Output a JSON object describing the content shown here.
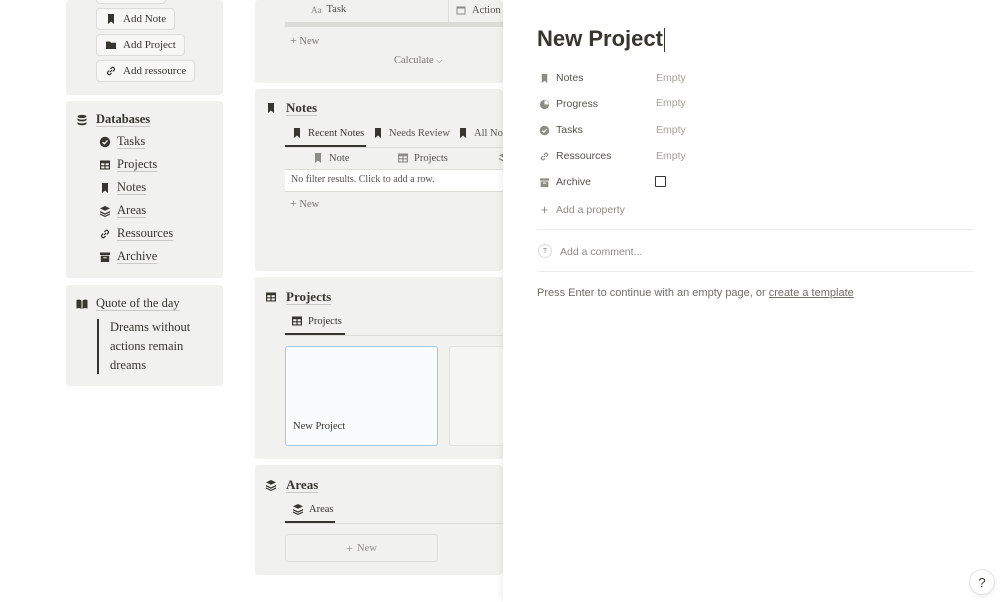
{
  "quick_actions": {
    "add_note": "Add Note",
    "add_project": "Add Project",
    "add_resource": "Add ressource"
  },
  "databases": {
    "title": "Databases",
    "items": [
      {
        "label": "Tasks",
        "icon": "check-circle-icon"
      },
      {
        "label": "Projects",
        "icon": "table-icon"
      },
      {
        "label": "Notes",
        "icon": "bookmark-icon"
      },
      {
        "label": "Areas",
        "icon": "layers-icon"
      },
      {
        "label": "Ressources",
        "icon": "link-icon"
      },
      {
        "label": "Archive",
        "icon": "archive-icon"
      }
    ]
  },
  "quote": {
    "title": "Quote of the day",
    "text": "Dreams without actions remain dreams"
  },
  "tasks_section": {
    "col_task": "Task",
    "col_action": "Action D",
    "new_label": "New",
    "calculate_label": "Calculate"
  },
  "notes_section": {
    "title": "Notes",
    "tabs": [
      "Recent Notes",
      "Needs Review",
      "All Note"
    ],
    "col_note": "Note",
    "col_projects": "Projects",
    "empty_text": "No filter results. Click to add a row.",
    "new_label": "New"
  },
  "projects_section": {
    "title": "Projects",
    "tab": "Projects",
    "card_title": "New Project"
  },
  "areas_section": {
    "title": "Areas",
    "tab": "Areas",
    "new_label": "New"
  },
  "panel": {
    "title": "New Project",
    "properties": [
      {
        "label": "Notes",
        "value": "Empty",
        "icon": "bookmark-icon"
      },
      {
        "label": "Progress",
        "value": "Empty",
        "icon": "progress-icon"
      },
      {
        "label": "Tasks",
        "value": "Empty",
        "icon": "check-circle-icon"
      },
      {
        "label": "Ressources",
        "value": "Empty",
        "icon": "link-icon"
      },
      {
        "label": "Archive",
        "value": "",
        "icon": "archive-icon"
      }
    ],
    "add_property": "Add a property",
    "comment_avatar": "T",
    "comment_placeholder": "Add a comment...",
    "hint_text": "Press Enter to continue with an empty page, or ",
    "hint_link": "create a template",
    "help_label": "?"
  }
}
